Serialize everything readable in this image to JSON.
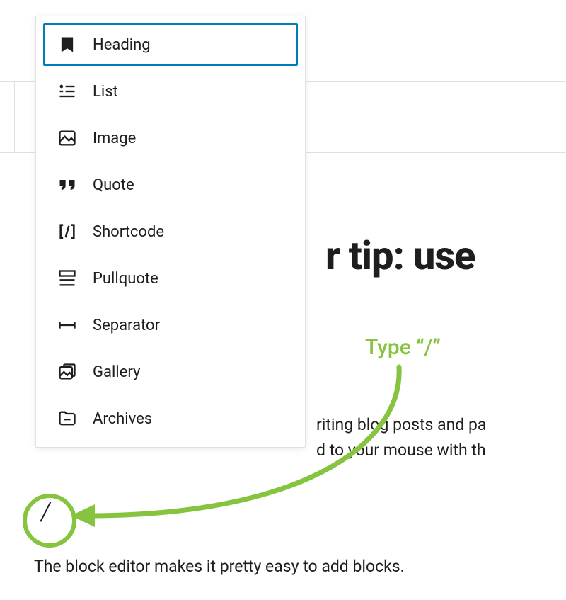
{
  "menu": {
    "items": [
      {
        "label": "Heading",
        "icon": "heading-icon",
        "selected": true
      },
      {
        "label": "List",
        "icon": "list-icon",
        "selected": false
      },
      {
        "label": "Image",
        "icon": "image-icon",
        "selected": false
      },
      {
        "label": "Quote",
        "icon": "quote-icon",
        "selected": false
      },
      {
        "label": "Shortcode",
        "icon": "shortcode-icon",
        "selected": false
      },
      {
        "label": "Pullquote",
        "icon": "pullquote-icon",
        "selected": false
      },
      {
        "label": "Separator",
        "icon": "separator-icon",
        "selected": false
      },
      {
        "label": "Gallery",
        "icon": "gallery-icon",
        "selected": false
      },
      {
        "label": "Archives",
        "icon": "archives-icon",
        "selected": false
      }
    ]
  },
  "background": {
    "title_fragment": "r tip: use",
    "para_line1_fragment": "riting blog posts and pa",
    "para_line2_fragment": "d to your mouse with th",
    "bottom_line": "The block editor makes it pretty easy to add blocks."
  },
  "annotation": {
    "label": "Type “/”",
    "slash": "/",
    "color": "#86c440"
  }
}
